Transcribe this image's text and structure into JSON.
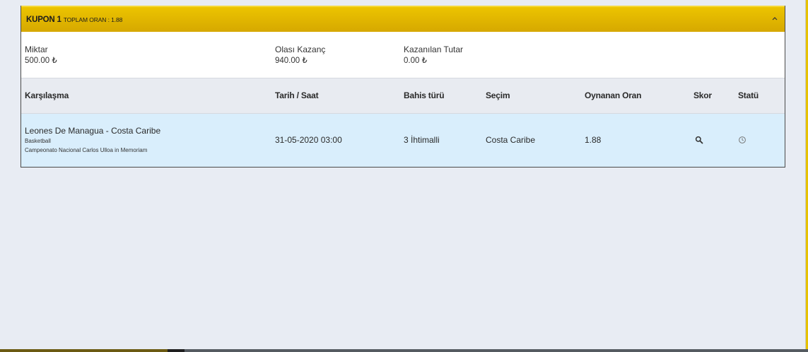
{
  "coupon": {
    "title": "KUPON 1",
    "subtitle": "TOPLAM ORAN : 1.88",
    "collapse_icon": "chevron-up-icon"
  },
  "summary": {
    "stake_label": "Miktar",
    "stake_value": "500.00 ₺",
    "potential_label": "Olası Kazanç",
    "potential_value": "940.00 ₺",
    "won_label": "Kazanılan Tutar",
    "won_value": "0.00 ₺"
  },
  "table": {
    "headers": [
      "Karşılaşma",
      "Tarih / Saat",
      "Bahis türü",
      "Seçim",
      "Oynanan Oran",
      "Skor",
      "Statü"
    ],
    "rows": [
      {
        "match": "Leones De Managua - Costa Caribe",
        "sport": "Basketball",
        "league": "Campeonato Nacional Carlos Ulloa in Memoriam",
        "datetime": "31-05-2020 03:00",
        "bet_type": "3 İhtimalli",
        "selection": "Costa Caribe",
        "odds": "1.88",
        "score_icon": "search-icon",
        "status_icon": "clock-icon"
      }
    ]
  },
  "colors": {
    "header_yellow": "#e6bd00",
    "row_blue": "#d9eefc",
    "background": "#e8ecf3"
  }
}
